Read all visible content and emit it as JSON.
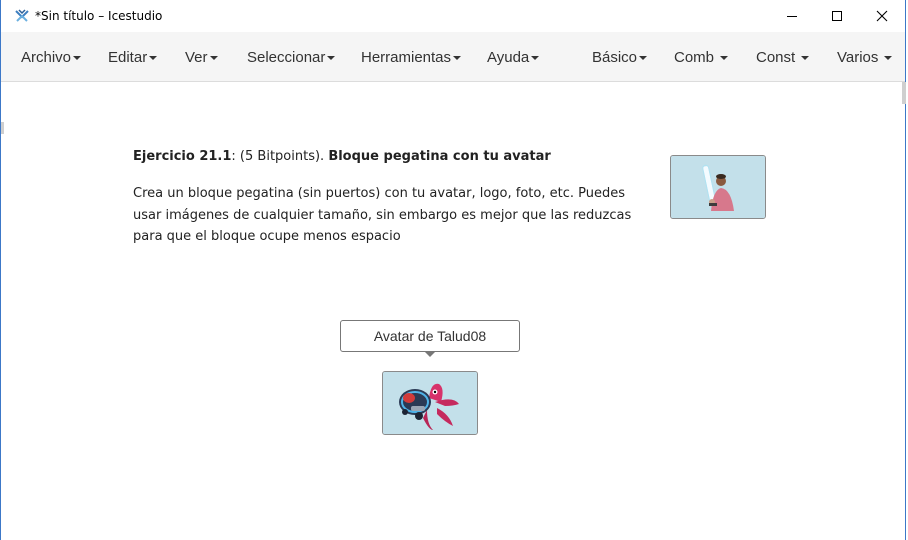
{
  "window": {
    "title": "*Sin título – Icestudio",
    "controls": {
      "minimize": "minimize-icon",
      "maximize": "maximize-icon",
      "close": "close-icon"
    }
  },
  "menubar": {
    "left": [
      "Archivo",
      "Editar",
      "Ver",
      "Seleccionar",
      "Herramientas",
      "Ayuda"
    ],
    "right": [
      "Básico",
      "Comb",
      "Const",
      "Varios"
    ]
  },
  "exercise": {
    "number": "Ejercicio 21.1",
    "points": ": (5 Bitpoints).",
    "heading": "Bloque pegatina con tu avatar",
    "description": "Crea un bloque pegatina (sin puertos) con tu avatar, logo, foto, etc. Puedes usar imágenes de cualquier tamaño, sin embargo es mejor que las reduzcas para que el bloque ocupe menos espacio"
  },
  "avatar_block": {
    "label": "Avatar de Talud08"
  },
  "colors": {
    "window_border": "#3c78c8",
    "menubar_bg": "#f5f5f5",
    "image_block_bg": "#bfdde8"
  }
}
